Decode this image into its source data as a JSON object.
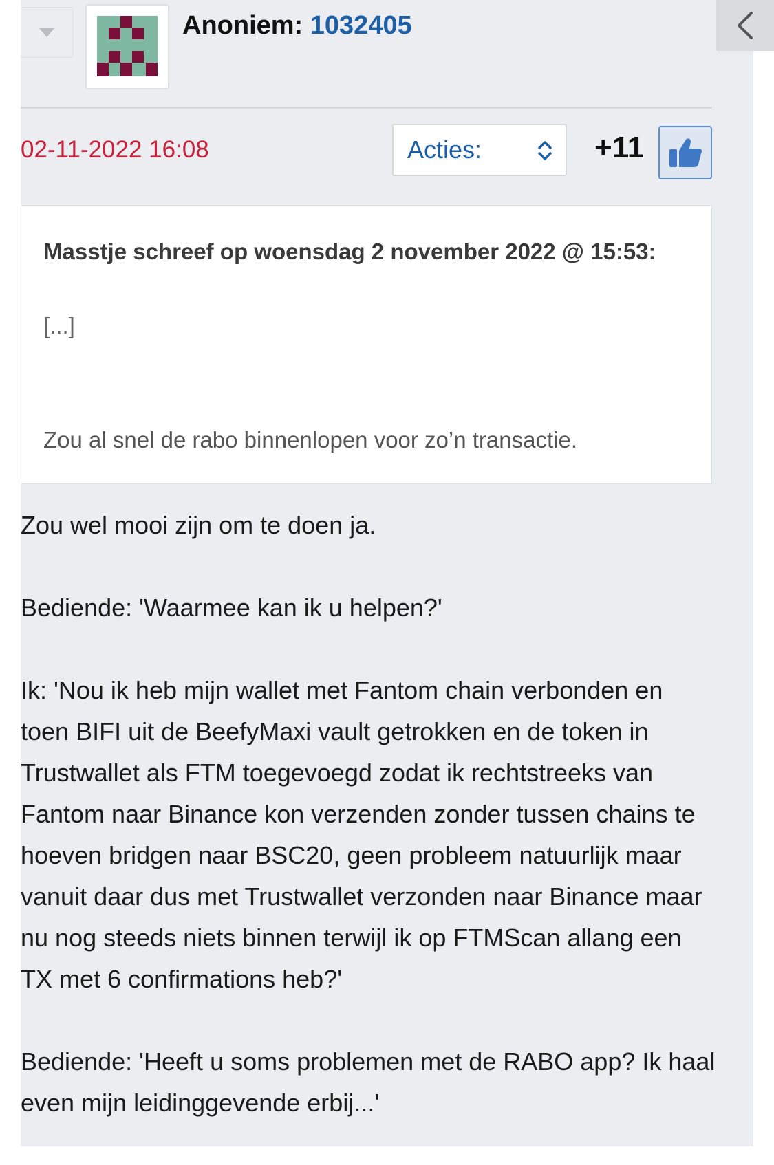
{
  "post": {
    "author_label": "Anoniem:",
    "author_id": "1032405",
    "date": "02-11-2022 16:08",
    "actions_label": "Acties:",
    "score": "+11",
    "quote": {
      "header": "Masstje schreef op woensdag 2 november 2022 @ 15:53:",
      "ellipsis": "[...]",
      "text": "Zou al snel de rabo binnenlopen voor zo’n transactie."
    },
    "paragraphs": [
      "Zou wel mooi zijn om te doen ja.",
      "Bediende: 'Waarmee kan ik u helpen?'",
      "Ik: 'Nou ik heb mijn wallet met Fantom chain verbonden en toen BIFI uit de BeefyMaxi vault getrokken en de token in Trustwallet als FTM toegevoegd zodat ik rechtstreeks van Fantom naar Binance kon verzenden zonder tussen chains te hoeven bridgen naar BSC20, geen probleem natuurlijk maar vanuit daar dus met Trustwallet verzonden naar Binance maar nu nog steeds niets binnen terwijl ik op FTMScan allang een TX met 6 confirmations heb?'",
      "Bediende: 'Heeft u soms problemen met de RABO app? Ik haal even mijn leidinggevende erbij...'"
    ]
  },
  "colors": {
    "background": "#ebedf0",
    "link_blue": "#1c5fa6",
    "date_red": "#c8223c",
    "avatar_fg": "#7a0f3a",
    "avatar_bg": "#7fb8a0"
  },
  "icons": {
    "collapse": "triangle-down-icon",
    "back": "chevron-left-icon",
    "select": "up-down-chevron-icon",
    "like": "thumbs-up-icon"
  }
}
